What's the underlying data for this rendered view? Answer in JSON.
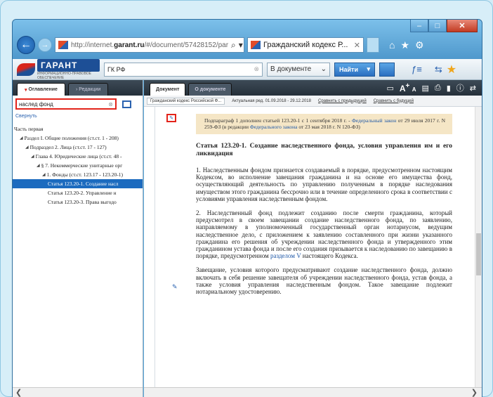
{
  "browser": {
    "address_prefix": "http://internet.",
    "address_domain": "garant.ru",
    "address_path": "/#/document/57428152/par",
    "tab_title": "Гражданский кодекс Р...",
    "minimize": "–",
    "maximize": "□",
    "close": "✕"
  },
  "toolbar": {
    "logo": "ГАРАНТ",
    "logo_sub": "ИНФОРМАЦИОННО-ПРАВОВОЕ ОБЕСПЕЧЕНИЕ",
    "search_value": "ГК РФ",
    "scope_label": "В документе",
    "find_label": "Найти"
  },
  "left": {
    "tabs": [
      {
        "label": "Оглавление"
      },
      {
        "label": "Редакции"
      }
    ],
    "search_value": "наслед фонд",
    "collapse_label": "Свернуть",
    "tree": [
      {
        "label": "Часть первая",
        "level": 0,
        "arrow": ""
      },
      {
        "label": "Раздел I. Общие положения (ст.ст. 1 - 208)",
        "level": 1,
        "arrow": "◢"
      },
      {
        "label": "Подраздел 2. Лица (ст.ст. 17 - 127)",
        "level": 2,
        "arrow": "◢"
      },
      {
        "label": "Глава 4. Юридические лица (ст.ст. 48 -",
        "level": 3,
        "arrow": "◢"
      },
      {
        "label": "§ 7. Некоммерческие унитарные орг",
        "level": 4,
        "arrow": "◢"
      },
      {
        "label": "1. Фонды (ст.ст. 123.17 - 123.20-1)",
        "level": 5,
        "arrow": "◢"
      },
      {
        "label": "Статья 123.20-1. Создание насл",
        "level": 6,
        "arrow": "",
        "selected": true
      },
      {
        "label": "Статья 123.20-2. Управление н",
        "level": 6,
        "arrow": ""
      },
      {
        "label": "Статья 123.20-3. Права выгодо",
        "level": 6,
        "arrow": ""
      }
    ]
  },
  "right": {
    "tabs": [
      {
        "label": "Документ"
      },
      {
        "label": "О документе"
      }
    ],
    "subbar": {
      "doc_name": "Гражданский кодекс Российской Ф...",
      "edition": "Актуальная ред. 01.09.2018 - 29.12.2018",
      "compare_prev": "Сравнить с предыдущей",
      "compare_next": "Сравнить с будущей"
    },
    "note_text_1": "Подпараграф 1 дополнен статьей 123.20-1 с 1 сентября 2018 г. - ",
    "note_link_1": "Федеральный закон",
    "note_text_2": " от 29 июля 2017 г. N 259-ФЗ (в редакции ",
    "note_link_2": "Федерального закона",
    "note_text_3": " от 23 мая 2018 г. N 120-ФЗ)",
    "article_title": "Статья 123.20-1. Создание наследственного фонда, условия управления им и его ликвидация",
    "para1": "1. Наследственным фондом признается создаваемый в порядке, предусмотренном настоящим Кодексом, во исполнение завещания гражданина и на основе его имущества фонд, осуществляющий деятельность по управлению полученным в порядке наследования имуществом этого гражданина бессрочно или в течение определенного срока в соответствии с условиями управления наследственным фондом.",
    "para2": "2. Наследственный фонд подлежит созданию после смерти гражданина, который предусмотрел в своем завещании создание наследственного фонда, по заявлению, направляемому в уполномоченный государственный орган нотариусом, ведущим наследственное дело, с приложением к заявлению составленного при жизни указанного гражданина его решения об учреждении наследственного фонда и утвержденного этим гражданином устава фонда и после его создания призывается к наследованию по завещанию в порядке, предусмотренном ",
    "para2_link": "разделом V",
    "para2_end": " настоящего Кодекса.",
    "para3": "Завещание, условия которого предусматривают создание наследственного фонда, должно включать в себя решение завещателя об учреждении наследственного фонда, устав фонда, а также условия управления наследственным фондом. Такое завещание подлежит нотариальному удостоверению."
  }
}
